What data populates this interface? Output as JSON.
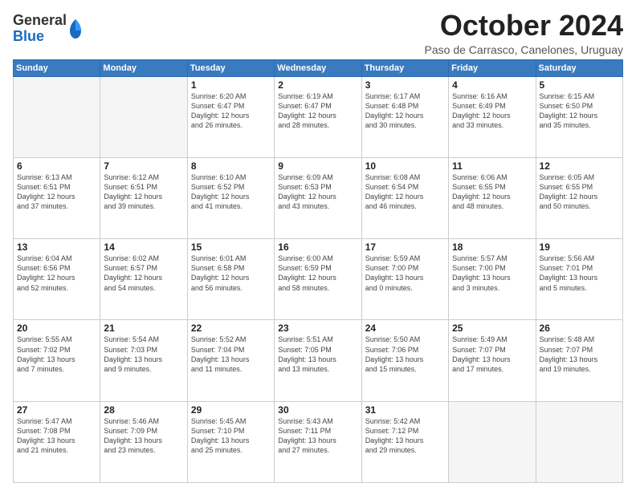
{
  "logo": {
    "general": "General",
    "blue": "Blue"
  },
  "title": "October 2024",
  "subtitle": "Paso de Carrasco, Canelones, Uruguay",
  "days_header": [
    "Sunday",
    "Monday",
    "Tuesday",
    "Wednesday",
    "Thursday",
    "Friday",
    "Saturday"
  ],
  "weeks": [
    [
      {
        "day": "",
        "info": ""
      },
      {
        "day": "",
        "info": ""
      },
      {
        "day": "1",
        "info": "Sunrise: 6:20 AM\nSunset: 6:47 PM\nDaylight: 12 hours\nand 26 minutes."
      },
      {
        "day": "2",
        "info": "Sunrise: 6:19 AM\nSunset: 6:47 PM\nDaylight: 12 hours\nand 28 minutes."
      },
      {
        "day": "3",
        "info": "Sunrise: 6:17 AM\nSunset: 6:48 PM\nDaylight: 12 hours\nand 30 minutes."
      },
      {
        "day": "4",
        "info": "Sunrise: 6:16 AM\nSunset: 6:49 PM\nDaylight: 12 hours\nand 33 minutes."
      },
      {
        "day": "5",
        "info": "Sunrise: 6:15 AM\nSunset: 6:50 PM\nDaylight: 12 hours\nand 35 minutes."
      }
    ],
    [
      {
        "day": "6",
        "info": "Sunrise: 6:13 AM\nSunset: 6:51 PM\nDaylight: 12 hours\nand 37 minutes."
      },
      {
        "day": "7",
        "info": "Sunrise: 6:12 AM\nSunset: 6:51 PM\nDaylight: 12 hours\nand 39 minutes."
      },
      {
        "day": "8",
        "info": "Sunrise: 6:10 AM\nSunset: 6:52 PM\nDaylight: 12 hours\nand 41 minutes."
      },
      {
        "day": "9",
        "info": "Sunrise: 6:09 AM\nSunset: 6:53 PM\nDaylight: 12 hours\nand 43 minutes."
      },
      {
        "day": "10",
        "info": "Sunrise: 6:08 AM\nSunset: 6:54 PM\nDaylight: 12 hours\nand 46 minutes."
      },
      {
        "day": "11",
        "info": "Sunrise: 6:06 AM\nSunset: 6:55 PM\nDaylight: 12 hours\nand 48 minutes."
      },
      {
        "day": "12",
        "info": "Sunrise: 6:05 AM\nSunset: 6:55 PM\nDaylight: 12 hours\nand 50 minutes."
      }
    ],
    [
      {
        "day": "13",
        "info": "Sunrise: 6:04 AM\nSunset: 6:56 PM\nDaylight: 12 hours\nand 52 minutes."
      },
      {
        "day": "14",
        "info": "Sunrise: 6:02 AM\nSunset: 6:57 PM\nDaylight: 12 hours\nand 54 minutes."
      },
      {
        "day": "15",
        "info": "Sunrise: 6:01 AM\nSunset: 6:58 PM\nDaylight: 12 hours\nand 56 minutes."
      },
      {
        "day": "16",
        "info": "Sunrise: 6:00 AM\nSunset: 6:59 PM\nDaylight: 12 hours\nand 58 minutes."
      },
      {
        "day": "17",
        "info": "Sunrise: 5:59 AM\nSunset: 7:00 PM\nDaylight: 13 hours\nand 0 minutes."
      },
      {
        "day": "18",
        "info": "Sunrise: 5:57 AM\nSunset: 7:00 PM\nDaylight: 13 hours\nand 3 minutes."
      },
      {
        "day": "19",
        "info": "Sunrise: 5:56 AM\nSunset: 7:01 PM\nDaylight: 13 hours\nand 5 minutes."
      }
    ],
    [
      {
        "day": "20",
        "info": "Sunrise: 5:55 AM\nSunset: 7:02 PM\nDaylight: 13 hours\nand 7 minutes."
      },
      {
        "day": "21",
        "info": "Sunrise: 5:54 AM\nSunset: 7:03 PM\nDaylight: 13 hours\nand 9 minutes."
      },
      {
        "day": "22",
        "info": "Sunrise: 5:52 AM\nSunset: 7:04 PM\nDaylight: 13 hours\nand 11 minutes."
      },
      {
        "day": "23",
        "info": "Sunrise: 5:51 AM\nSunset: 7:05 PM\nDaylight: 13 hours\nand 13 minutes."
      },
      {
        "day": "24",
        "info": "Sunrise: 5:50 AM\nSunset: 7:06 PM\nDaylight: 13 hours\nand 15 minutes."
      },
      {
        "day": "25",
        "info": "Sunrise: 5:49 AM\nSunset: 7:07 PM\nDaylight: 13 hours\nand 17 minutes."
      },
      {
        "day": "26",
        "info": "Sunrise: 5:48 AM\nSunset: 7:07 PM\nDaylight: 13 hours\nand 19 minutes."
      }
    ],
    [
      {
        "day": "27",
        "info": "Sunrise: 5:47 AM\nSunset: 7:08 PM\nDaylight: 13 hours\nand 21 minutes."
      },
      {
        "day": "28",
        "info": "Sunrise: 5:46 AM\nSunset: 7:09 PM\nDaylight: 13 hours\nand 23 minutes."
      },
      {
        "day": "29",
        "info": "Sunrise: 5:45 AM\nSunset: 7:10 PM\nDaylight: 13 hours\nand 25 minutes."
      },
      {
        "day": "30",
        "info": "Sunrise: 5:43 AM\nSunset: 7:11 PM\nDaylight: 13 hours\nand 27 minutes."
      },
      {
        "day": "31",
        "info": "Sunrise: 5:42 AM\nSunset: 7:12 PM\nDaylight: 13 hours\nand 29 minutes."
      },
      {
        "day": "",
        "info": ""
      },
      {
        "day": "",
        "info": ""
      }
    ]
  ]
}
